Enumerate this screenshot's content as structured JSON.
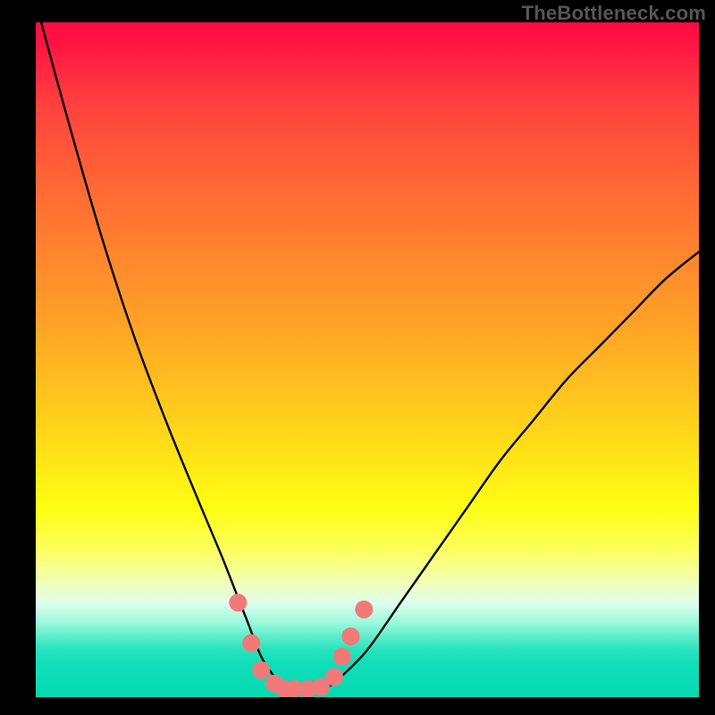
{
  "watermark": "TheBottleneck.com",
  "chart_data": {
    "type": "line",
    "title": "",
    "xlabel": "",
    "ylabel": "",
    "xlim": [
      0,
      100
    ],
    "ylim": [
      0,
      100
    ],
    "series": [
      {
        "name": "bottleneck-curve",
        "x": [
          0,
          5,
          10,
          15,
          20,
          25,
          28,
          30,
          32,
          34,
          36,
          37.5,
          39,
          42,
          44,
          46,
          50,
          55,
          60,
          65,
          70,
          75,
          80,
          85,
          90,
          95,
          100
        ],
        "y": [
          103,
          85,
          68,
          53,
          40,
          28,
          21,
          16,
          11,
          6,
          3,
          1.5,
          1,
          1,
          1.5,
          3,
          7,
          14,
          21,
          28,
          35,
          41,
          47,
          52,
          57,
          62,
          66
        ]
      }
    ],
    "markers": {
      "name": "highlight-dots",
      "x": [
        30.5,
        32.5,
        34,
        36,
        37.5,
        39,
        41,
        43,
        45,
        46.2,
        47.5,
        49.5
      ],
      "y": [
        14,
        8,
        4,
        2,
        1.2,
        1.2,
        1.2,
        1.5,
        3,
        6,
        9,
        13
      ],
      "color": "#f07a7a",
      "size": 10
    },
    "gradient_stops": [
      {
        "pos": 0.0,
        "color": "#ff0b41"
      },
      {
        "pos": 0.12,
        "color": "#ff403e"
      },
      {
        "pos": 0.25,
        "color": "#ff6a34"
      },
      {
        "pos": 0.45,
        "color": "#ffa326"
      },
      {
        "pos": 0.6,
        "color": "#ffd41a"
      },
      {
        "pos": 0.72,
        "color": "#fffe13"
      },
      {
        "pos": 0.83,
        "color": "#f1ffb7"
      },
      {
        "pos": 0.89,
        "color": "#9af8db"
      },
      {
        "pos": 1.0,
        "color": "#04dab3"
      }
    ]
  }
}
